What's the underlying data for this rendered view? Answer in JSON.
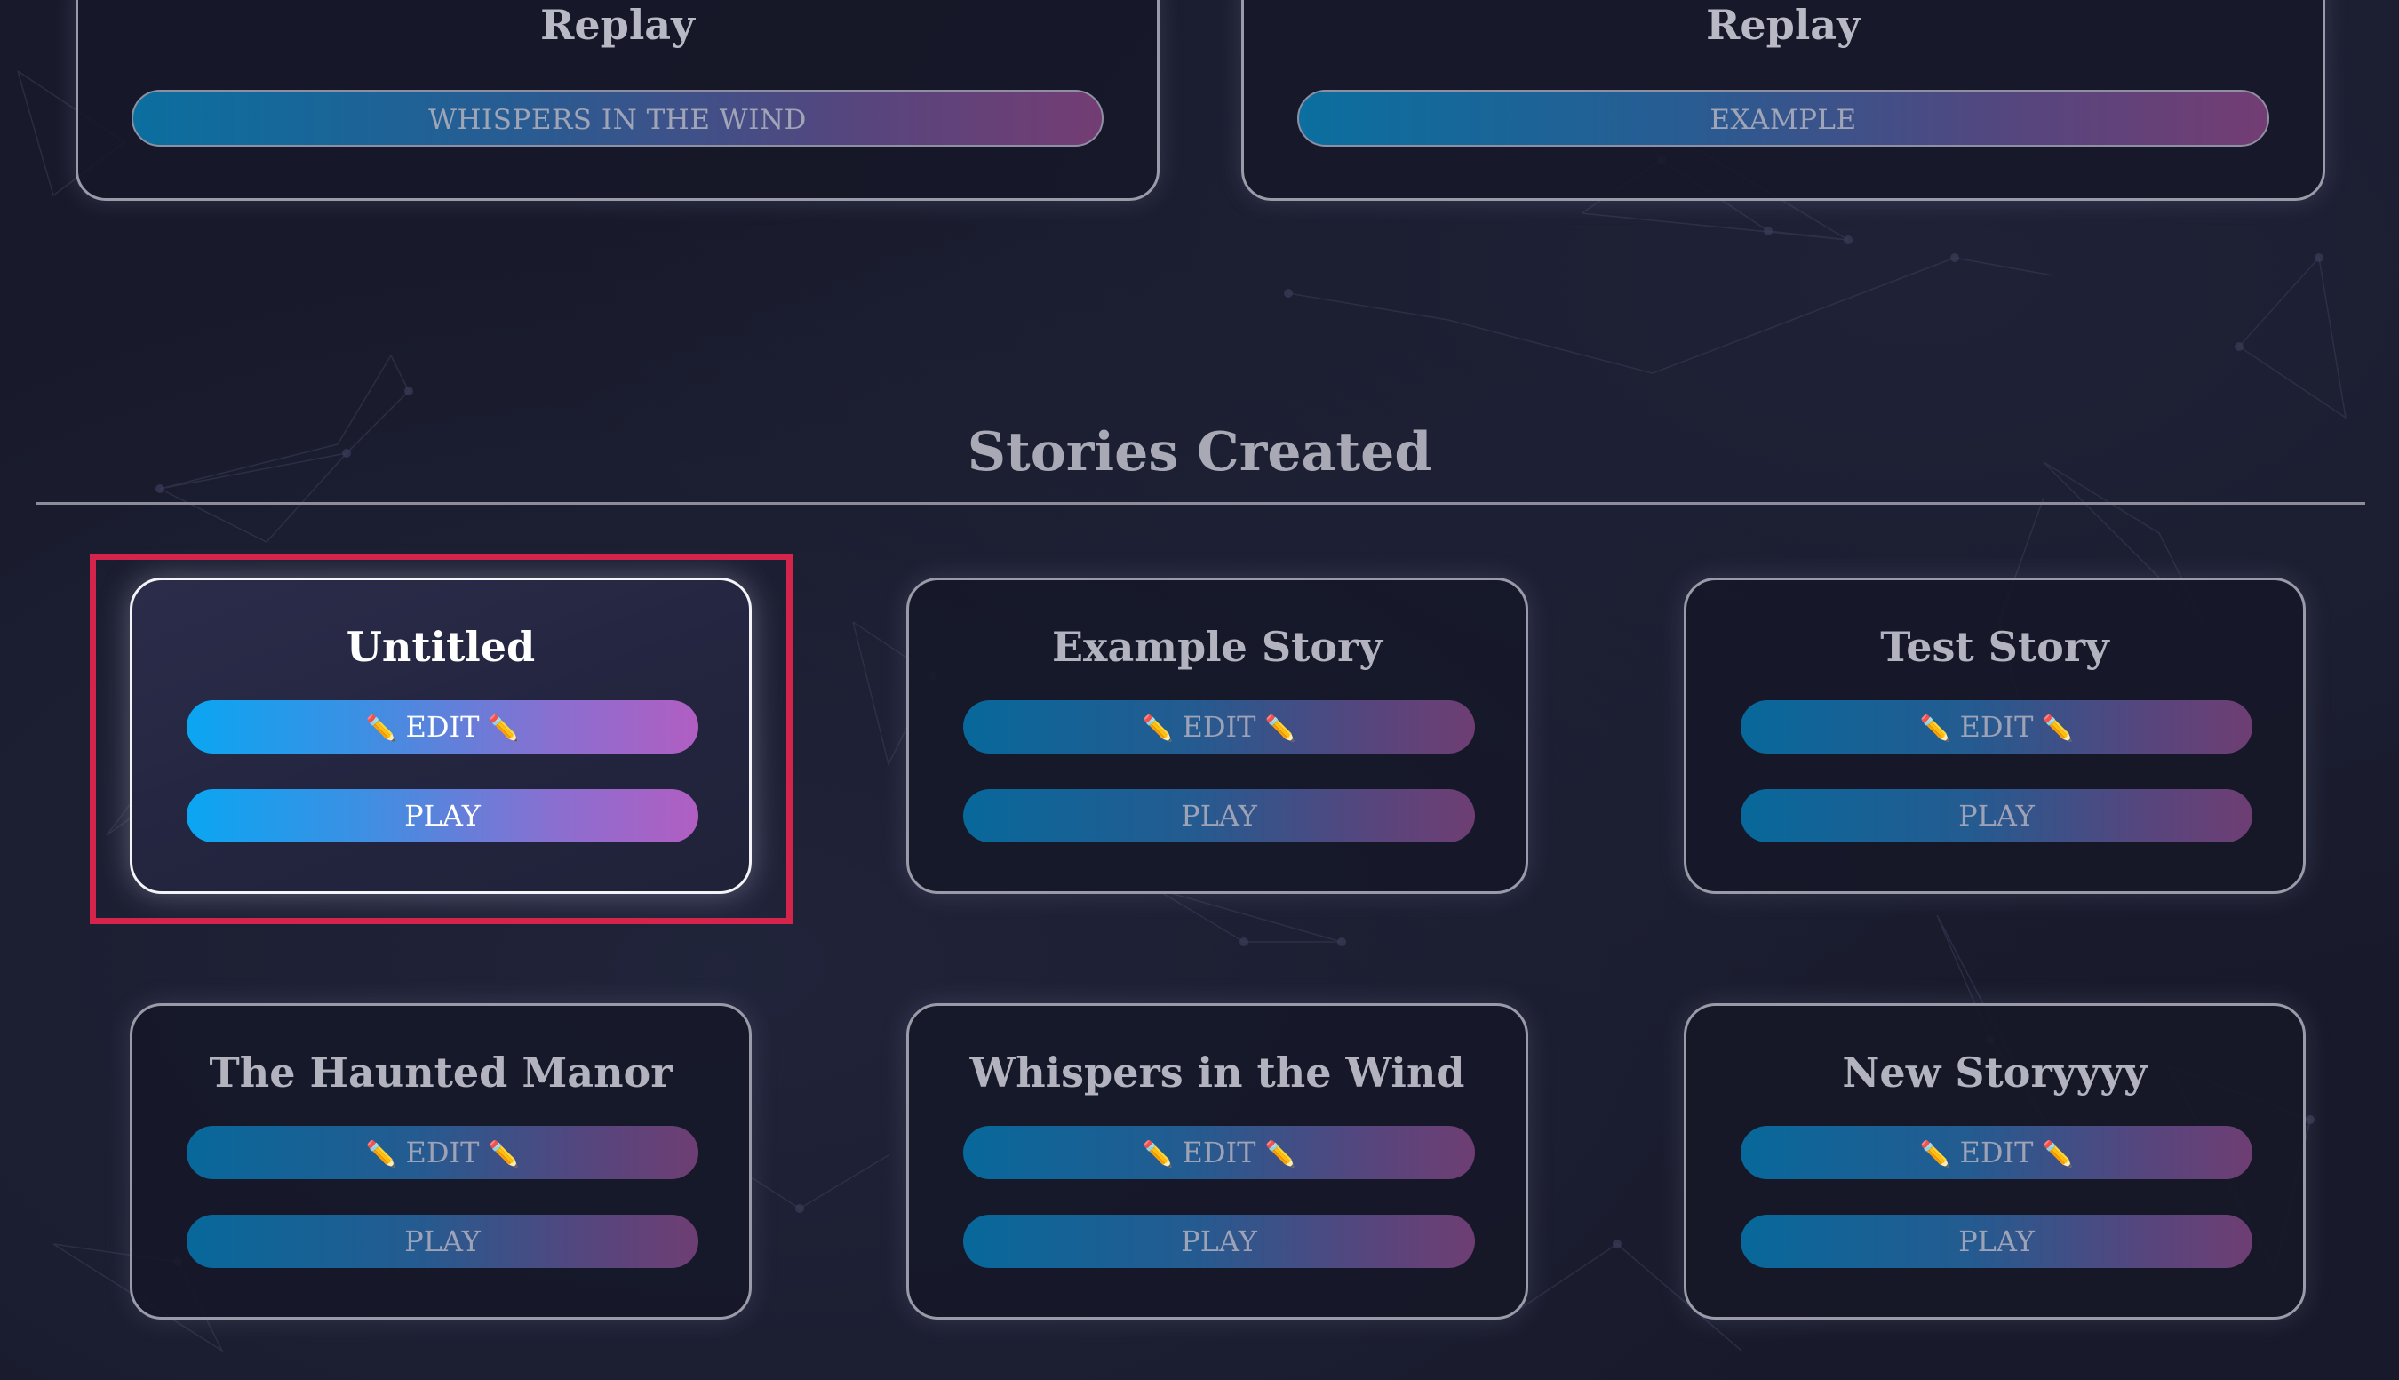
{
  "replay_cards": [
    {
      "title": "Replay",
      "button": "WHISPERS IN THE WIND"
    },
    {
      "title": "Replay",
      "button": "EXAMPLE"
    }
  ],
  "section": {
    "title": "Stories Created"
  },
  "stories": [
    {
      "title": "Untitled",
      "edit_label": "EDIT",
      "play_label": "PLAY"
    },
    {
      "title": "Example Story",
      "edit_label": "EDIT",
      "play_label": "PLAY"
    },
    {
      "title": "Test Story",
      "edit_label": "EDIT",
      "play_label": "PLAY"
    },
    {
      "title": "The Haunted Manor",
      "edit_label": "EDIT",
      "play_label": "PLAY"
    },
    {
      "title": "Whispers in the Wind",
      "edit_label": "EDIT",
      "play_label": "PLAY"
    },
    {
      "title": "New Storyyyy",
      "edit_label": "EDIT",
      "play_label": "PLAY"
    }
  ],
  "icons": {
    "edit": "pencil-icon"
  },
  "colors": {
    "background": "#181a2b",
    "highlight": "#d4244b",
    "button_start": "#0aa6f2",
    "button_end": "#b15ec2"
  }
}
